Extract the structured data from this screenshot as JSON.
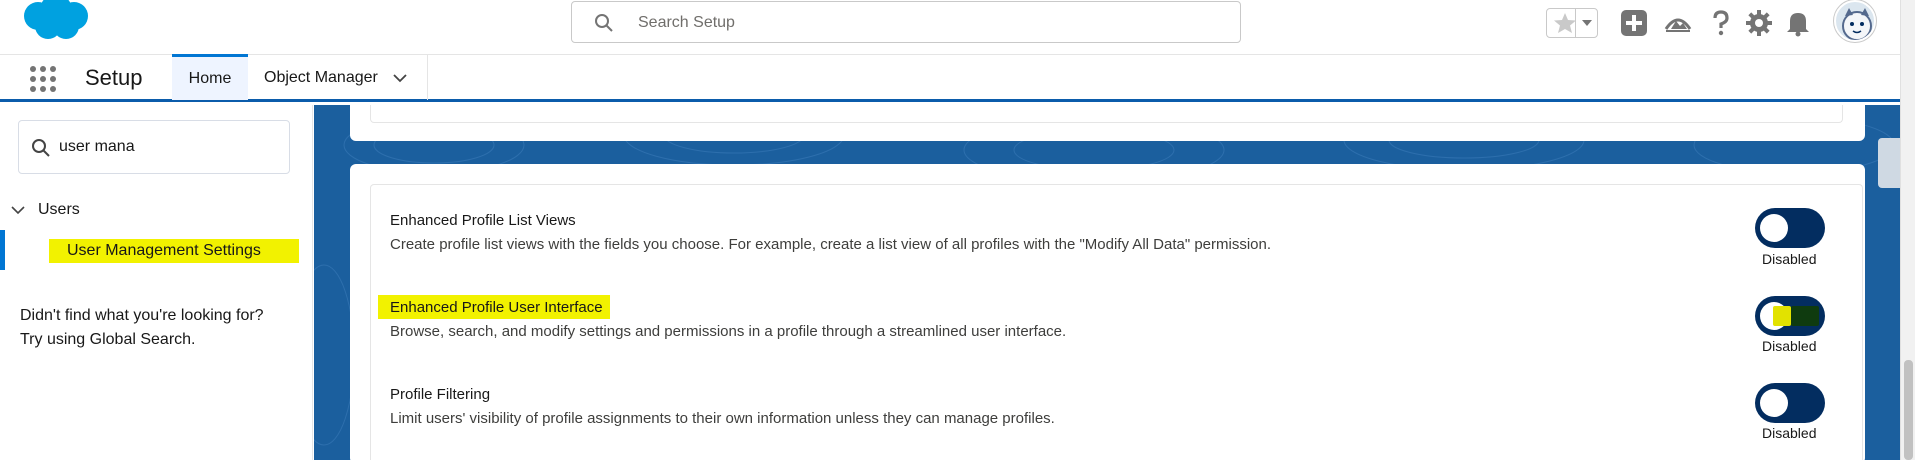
{
  "header": {
    "search_placeholder": "Search Setup",
    "icons": [
      "salesforce-logo",
      "search-icon",
      "favorites-star-icon",
      "favorites-dropdown-icon",
      "global-actions-plus-icon",
      "trailhead-icon",
      "help-icon",
      "gear-icon",
      "notifications-bell-icon",
      "user-avatar"
    ]
  },
  "nav": {
    "app_name": "Setup",
    "tabs": [
      {
        "label": "Home",
        "active": true
      },
      {
        "label": "Object Manager",
        "active": false
      }
    ]
  },
  "sidebar": {
    "quick_find_value": "user mana",
    "tree_parent": "Users",
    "tree_item": "User Management Settings",
    "not_found_line1": "Didn't find what you're looking for?",
    "not_found_line2": "Try using Global Search."
  },
  "settings": [
    {
      "title": "Enhanced Profile List Views",
      "description": "Create profile list views with the fields you choose. For example, create a list view of all profiles with the \"Modify All Data\" permission.",
      "status": "Disabled"
    },
    {
      "title": "Enhanced Profile User Interface",
      "description": "Browse, search, and modify settings and permissions in a profile through a streamlined user interface.",
      "status": "Disabled"
    },
    {
      "title": "Profile Filtering",
      "description": "Limit users' visibility of profile assignments to their own information unless they can manage profiles.",
      "status": "Disabled"
    }
  ],
  "colors": {
    "brand_blue": "#0176d3",
    "toggle_bg": "#032d60",
    "highlight_yellow": "#f2f200",
    "content_bg": "#1b5f9e"
  }
}
